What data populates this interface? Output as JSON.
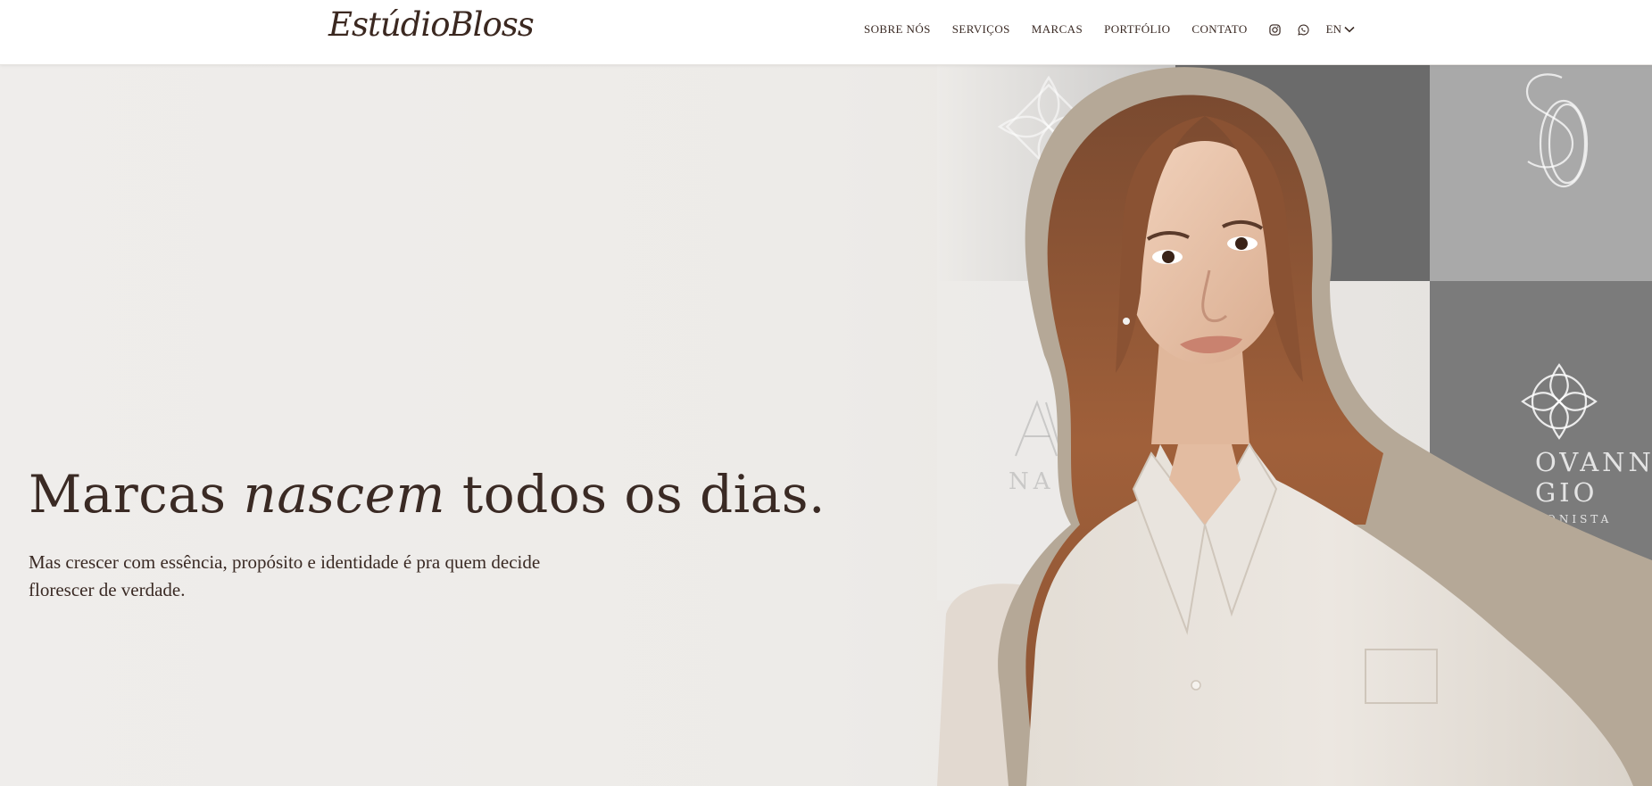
{
  "header": {
    "logo": "EstúdioBloss",
    "nav": [
      "SOBRE NÓS",
      "SERVIÇOS",
      "MARCAS",
      "PORTFÓLIO",
      "CONTATO"
    ],
    "social_icons": [
      "instagram-icon",
      "whatsapp-icon"
    ],
    "language": "EN"
  },
  "hero": {
    "headline_before": "Marcas ",
    "headline_em": "nascem",
    "headline_after": " todos os dias.",
    "subheadline": "Mas crescer com essência, propósito e identidade é pra quem decide florescer de verdade.",
    "watermarks": {
      "av_name": "NA VIEI",
      "brand_line1": "OVANNA",
      "brand_line2": "GIO",
      "brand_sub": "ONISTA"
    }
  },
  "colors": {
    "text": "#3a2a24",
    "hero_bg": "#edebe8",
    "tile_dark": "#6b6b6b",
    "tile_grey": "#a9a9a9",
    "outline": "#b5a897"
  }
}
